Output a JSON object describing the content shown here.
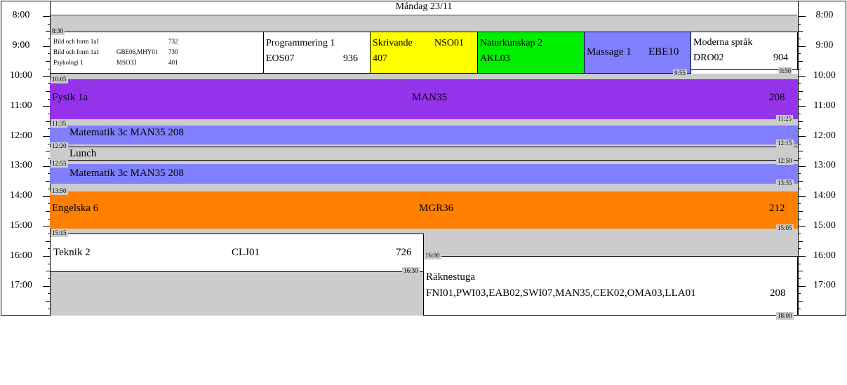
{
  "day": {
    "title": "Måndag 23/11"
  },
  "hours": [
    "8:00",
    "9:00",
    "10:00",
    "11:00",
    "12:00",
    "13:00",
    "14:00",
    "15:00",
    "16:00",
    "17:00"
  ],
  "lessons": {
    "bild1": {
      "name": "Bild och form 1a1",
      "code": "",
      "room": "732"
    },
    "bild2": {
      "name": "Bild och form 1a1",
      "code": "GBE06,MHY01",
      "room": "730"
    },
    "psyk": {
      "name": "Psykologi 1",
      "code": "MSO33",
      "room": "401"
    },
    "prog": {
      "name": "Programmering 1",
      "code": "EOS07",
      "room": "936"
    },
    "skriv": {
      "name": "Skrivande",
      "code": "NSO01",
      "room": "407"
    },
    "natur": {
      "name": "Naturkunskap 2",
      "code": "AKL03"
    },
    "massage": {
      "name": "Massage 1",
      "code": "EBE10"
    },
    "moderna": {
      "name": "Moderna språk",
      "code": "DRO02",
      "room": "904"
    },
    "fysik": {
      "name": "Fysik 1a",
      "code": "MAN35",
      "room": "208"
    },
    "mat1": {
      "text": "Matematik 3c MAN35 208"
    },
    "lunch": {
      "text": "Lunch"
    },
    "mat2": {
      "text": "Matematik 3c MAN35 208"
    },
    "eng": {
      "name": "Engelska 6",
      "code": "MGR36",
      "room": "212"
    },
    "teknik": {
      "name": "Teknik 2",
      "code": "CLJ01",
      "room": "726"
    },
    "rakne": {
      "name": "Räknestuga",
      "code": "FNI01,PWI03,EAB02,SWI07,MAN35,CEK02,OMA03,LLA01",
      "room": "208"
    }
  },
  "times": {
    "t0830": "8:30",
    "t0955": "9:55",
    "t0950": "9:50",
    "t1005": "10:05",
    "t1125": "11:25",
    "t1135": "11:35",
    "t1215": "12:15",
    "t1220": "12:20",
    "t1250": "12:50",
    "t1255": "12:55",
    "t1335": "13:35",
    "t1350": "13:50",
    "t1505": "15:05",
    "t1515": "15:15",
    "t1600": "16:00",
    "t1630": "16:30",
    "t1800": "18:00"
  },
  "colors": {
    "grey": "#cccccc",
    "yellow": "#ffff00",
    "green": "#00ee00",
    "periwinkle": "#8080ff",
    "purple": "#9333ea",
    "orange": "#ff8000"
  }
}
